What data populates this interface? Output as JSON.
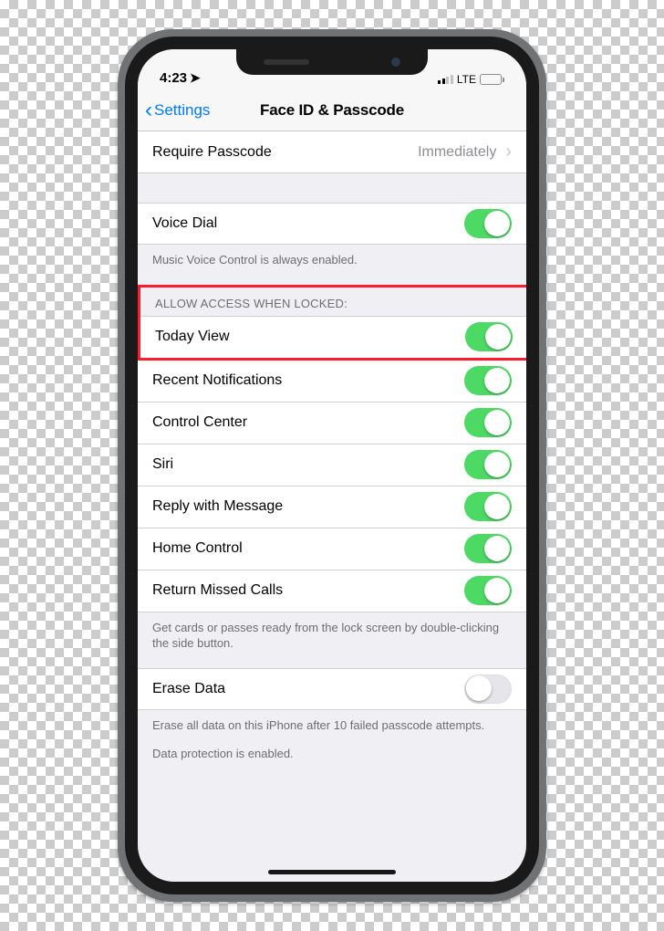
{
  "status": {
    "time": "4:23",
    "network": "LTE"
  },
  "nav": {
    "back_label": "Settings",
    "title": "Face ID & Passcode"
  },
  "sections": {
    "require": {
      "label": "Require Passcode",
      "value": "Immediately"
    },
    "voice": {
      "dial_label": "Voice Dial",
      "footer": "Music Voice Control is always enabled."
    },
    "allow": {
      "header": "Allow Access When Locked:",
      "items": {
        "today": "Today View",
        "recent": "Recent Notifications",
        "control": "Control Center",
        "siri": "Siri",
        "reply": "Reply with Message",
        "home": "Home Control",
        "missed": "Return Missed Calls"
      },
      "footer": "Get cards or passes ready from the lock screen by double-clicking the side button."
    },
    "erase": {
      "label": "Erase Data",
      "footer1": "Erase all data on this iPhone after 10 failed passcode attempts.",
      "footer2": "Data protection is enabled."
    }
  }
}
